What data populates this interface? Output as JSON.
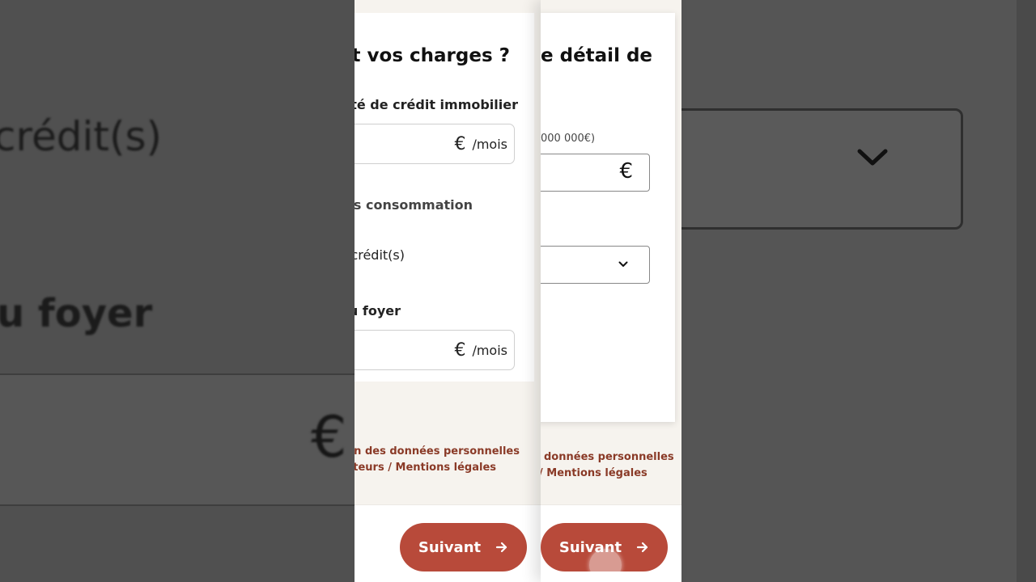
{
  "background": {
    "left_text_credit": "crédit(s)",
    "left_text_foyer": "u foyer",
    "left_icon": "euro-icon",
    "right_icon": "chevron-down-icon"
  },
  "panel_charges": {
    "title": "t vos charges ?",
    "label_mortgage": "lité de crédit immobilier",
    "mortgage_input": {
      "value": "",
      "currency_icon": "€",
      "suffix": "/mois"
    },
    "label_consumer": "ts consommation",
    "credit_option": "crédit(s)",
    "label_household": "u foyer",
    "household_input": {
      "value": "",
      "currency_icon": "€",
      "suffix": "/mois"
    },
    "footer_line1": "stion des données personnelles",
    "footer_line2": "arateurs / Mentions légales",
    "next_button": "Suivant"
  },
  "panel_detail": {
    "title": "e détail de",
    "hint": "000 000€)",
    "amount_input": {
      "value": "",
      "currency_icon": "€"
    },
    "select": {
      "selected": ""
    },
    "footer_line1": "données personnelles",
    "footer_line2": "/ Mentions légales",
    "next_button": "Suivant"
  },
  "colors": {
    "accent": "#b84a3a",
    "footer_link": "#8a3a27",
    "panel_bg": "#f6f3ee"
  }
}
